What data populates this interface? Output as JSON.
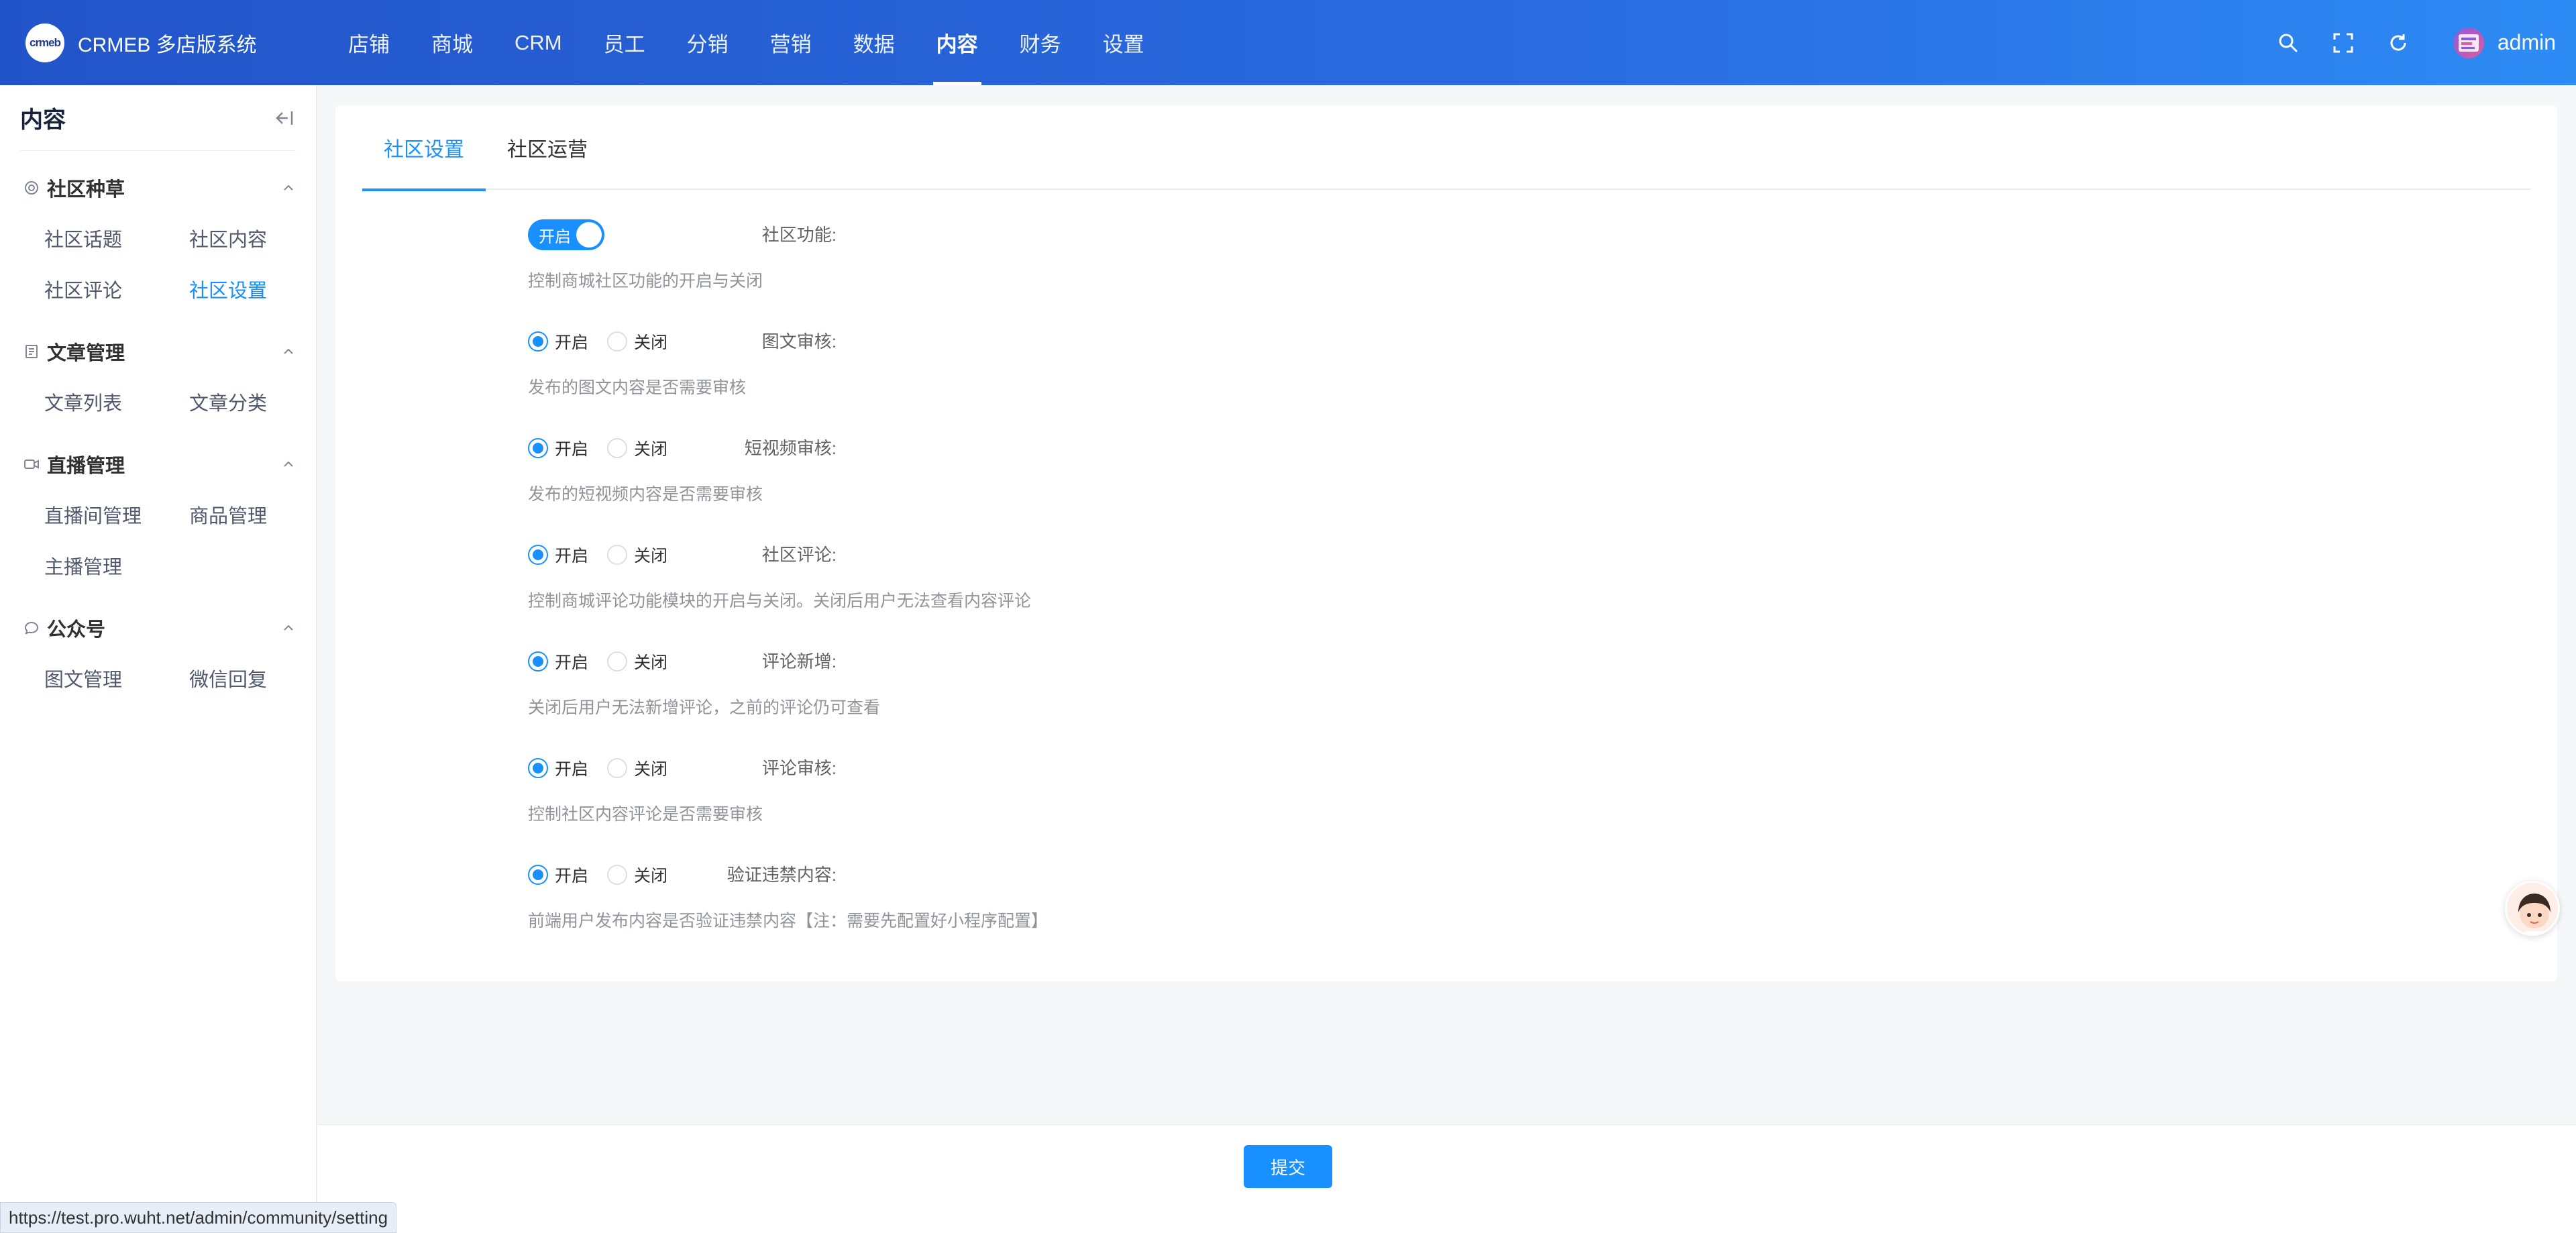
{
  "header": {
    "logo_mark": "crmeb",
    "app_name": "CRMEB 多店版系统",
    "nav": [
      {
        "label": "店铺",
        "name": "store"
      },
      {
        "label": "商城",
        "name": "mall"
      },
      {
        "label": "CRM",
        "name": "crm"
      },
      {
        "label": "员工",
        "name": "staff"
      },
      {
        "label": "分销",
        "name": "distribution"
      },
      {
        "label": "营销",
        "name": "marketing"
      },
      {
        "label": "数据",
        "name": "data"
      },
      {
        "label": "内容",
        "name": "content",
        "active": true
      },
      {
        "label": "财务",
        "name": "finance"
      },
      {
        "label": "设置",
        "name": "settings"
      }
    ],
    "username": "admin",
    "icons": [
      "search-icon",
      "fullscreen-icon",
      "refresh-icon"
    ]
  },
  "sidebar": {
    "title": "内容",
    "groups": [
      {
        "label": "社区种草",
        "icon": "community-icon",
        "items": [
          "社区话题",
          "社区内容",
          "社区评论",
          "社区设置"
        ],
        "active_item": "社区设置"
      },
      {
        "label": "文章管理",
        "icon": "article-icon",
        "items": [
          "文章列表",
          "文章分类"
        ]
      },
      {
        "label": "直播管理",
        "icon": "live-icon",
        "items": [
          "直播间管理",
          "商品管理",
          "主播管理"
        ]
      },
      {
        "label": "公众号",
        "icon": "wechat-icon",
        "items": [
          "图文管理",
          "微信回复"
        ]
      }
    ]
  },
  "tabs": [
    "社区设置",
    "社区运营"
  ],
  "form": {
    "switch_row": {
      "label": "社区功能:",
      "switch_text": "开启",
      "value": true,
      "desc": "控制商城社区功能的开启与关闭"
    },
    "options": {
      "on": "开启",
      "off": "关闭"
    },
    "radio_rows": [
      {
        "label": "图文审核:",
        "value": "on",
        "desc": "发布的图文内容是否需要审核"
      },
      {
        "label": "短视频审核:",
        "value": "on",
        "desc": "发布的短视频内容是否需要审核"
      },
      {
        "label": "社区评论:",
        "value": "on",
        "desc": "控制商城评论功能模块的开启与关闭。关闭后用户无法查看内容评论"
      },
      {
        "label": "评论新增:",
        "value": "on",
        "desc": "关闭后用户无法新增评论，之前的评论仍可查看"
      },
      {
        "label": "评论审核:",
        "value": "on",
        "desc": "控制社区内容评论是否需要审核"
      },
      {
        "label": "验证违禁内容:",
        "value": "on",
        "desc": "前端用户发布内容是否验证违禁内容【注：需要先配置好小程序配置】"
      }
    ]
  },
  "footer": {
    "submit_label": "提交"
  },
  "status_bar": {
    "url": "https://test.pro.wuht.net/admin/community/setting"
  },
  "colors": {
    "primary": "#1890ff",
    "header_start": "#2254c9",
    "header_end": "#2d8bf4"
  }
}
